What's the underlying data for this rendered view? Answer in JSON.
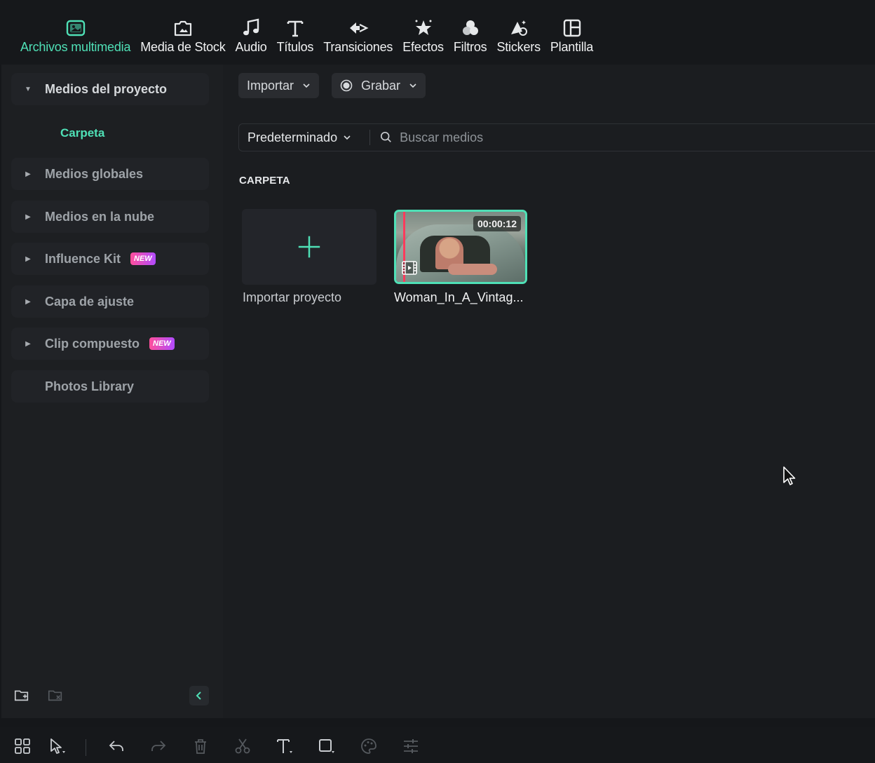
{
  "topbar": {
    "tabs": [
      {
        "label": "Archivos multimedia",
        "icon": "media-icon",
        "active": true
      },
      {
        "label": "Media de Stock",
        "icon": "stock-media-icon",
        "active": false
      },
      {
        "label": "Audio",
        "icon": "music-note-icon",
        "active": false
      },
      {
        "label": "Títulos",
        "icon": "title-text-icon",
        "active": false
      },
      {
        "label": "Transiciones",
        "icon": "transition-icon",
        "active": false
      },
      {
        "label": "Efectos",
        "icon": "effects-star-icon",
        "active": false
      },
      {
        "label": "Filtros",
        "icon": "filters-circles-icon",
        "active": false
      },
      {
        "label": "Stickers",
        "icon": "sticker-icon",
        "active": false
      },
      {
        "label": "Plantilla",
        "icon": "template-icon",
        "active": false
      }
    ]
  },
  "sidebar": {
    "items": [
      {
        "label": "Medios del proyecto",
        "expanded": true
      },
      {
        "label": "Carpeta",
        "sub": true
      },
      {
        "label": "Medios globales"
      },
      {
        "label": "Medios en la nube"
      },
      {
        "label": "Influence Kit",
        "badge": "NEW"
      },
      {
        "label": "Capa de ajuste"
      },
      {
        "label": "Clip compuesto",
        "badge": "NEW"
      },
      {
        "label": "Photos Library"
      }
    ]
  },
  "main": {
    "import_label": "Importar",
    "record_label": "Grabar",
    "sort_label": "Predeterminado",
    "search_placeholder": "Buscar medios",
    "folder_label": "CARPETA",
    "import_project_label": "Importar proyecto",
    "clip": {
      "name": "Woman_In_A_Vintag...",
      "duration": "00:00:12"
    }
  },
  "colors": {
    "accent": "#4fe0b6",
    "background": "#1b1d20",
    "badge_gradient": [
      "#ff4f9b",
      "#b14bff"
    ],
    "playhead": "#ff3b5c"
  }
}
